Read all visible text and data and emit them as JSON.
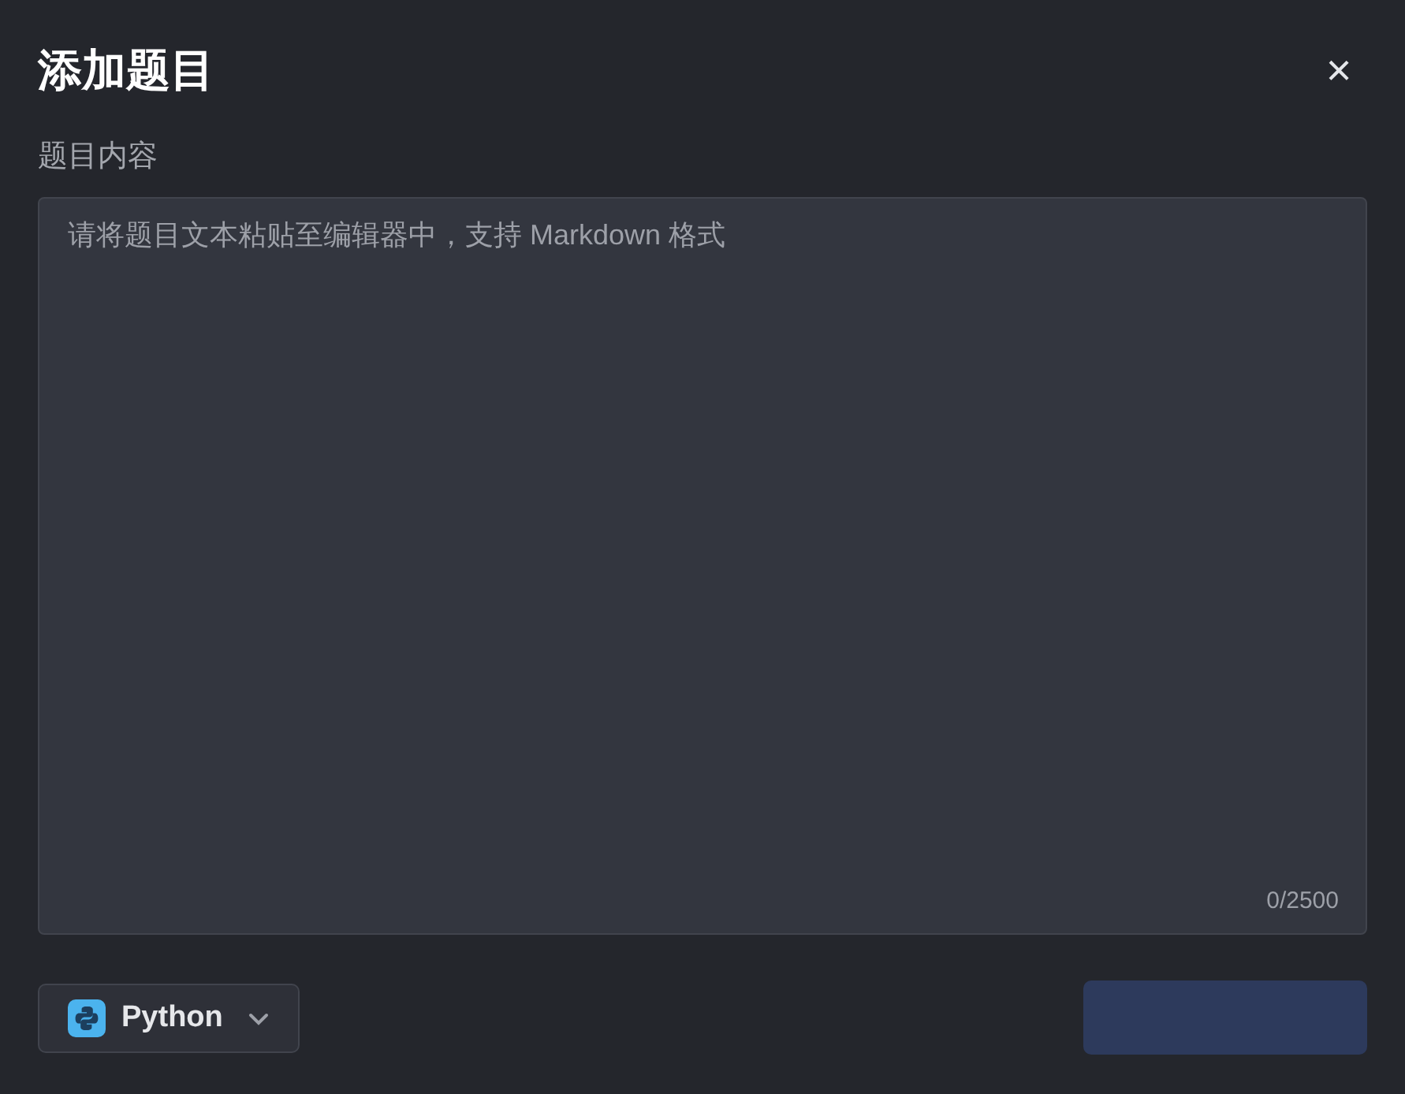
{
  "dialog": {
    "title": "添加题目",
    "close": "×"
  },
  "field": {
    "label": "题目内容",
    "placeholder": "请将题目文本粘贴至编辑器中，支持 Markdown 格式",
    "counter": "0/2500"
  },
  "language_select": {
    "value": "Python"
  },
  "action_button": {
    "disabled": true
  }
}
